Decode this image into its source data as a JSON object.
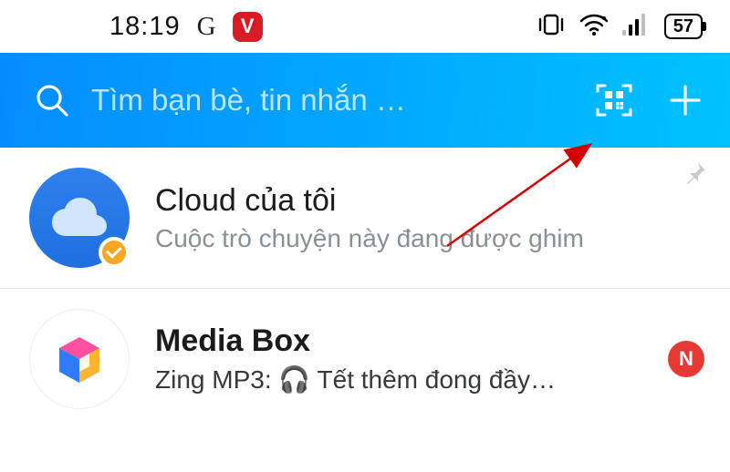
{
  "status": {
    "time": "18:19",
    "g_label": "G",
    "v_label": "V",
    "battery": "57"
  },
  "header": {
    "search_placeholder": "Tìm bạn bè, tin nhắn …"
  },
  "chats": [
    {
      "title": "Cloud của tôi",
      "subtitle": "Cuộc trò chuyện này đang được ghim",
      "pinned": true
    },
    {
      "title": "Media Box",
      "subtitle": "Zing MP3: 🎧 Tết thêm đong đầy…",
      "unread": "N"
    }
  ]
}
